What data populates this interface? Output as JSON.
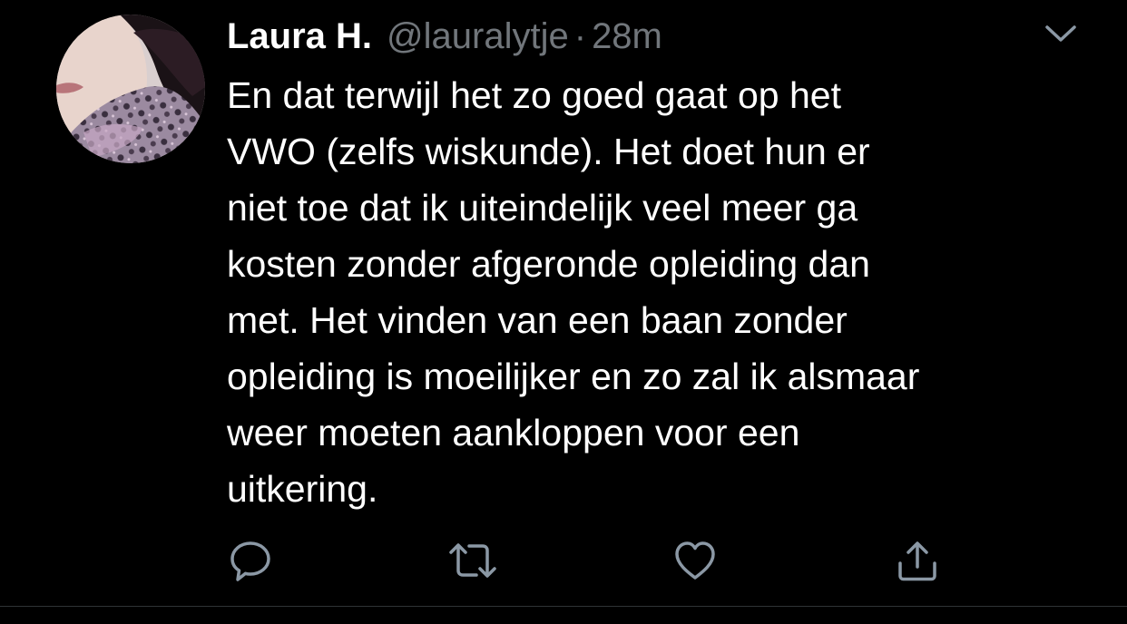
{
  "tweet": {
    "display_name": "Laura H.",
    "handle": "@lauralytje",
    "separator": "·",
    "time": "28m",
    "text": "En dat terwijl het zo goed gaat op het\nVWO (zelfs wiskunde). Het doet hun er\nniet toe dat ik uiteindelijk veel meer ga\nkosten zonder afgeronde opleiding dan\nmet. Het vinden van een baan zonder\nopleiding is moeilijker en zo zal ik alsmaar\nweer moeten aankloppen voor een\nuitkering."
  },
  "icons": {
    "menu": "chevron-down-icon",
    "reply": "reply-icon",
    "retweet": "retweet-icon",
    "like": "heart-icon",
    "share": "share-icon"
  },
  "colors": {
    "background": "#000000",
    "primary_text": "#ffffff",
    "secondary_text": "#71767b",
    "icon": "#8b98a5",
    "divider": "#2f3336"
  }
}
